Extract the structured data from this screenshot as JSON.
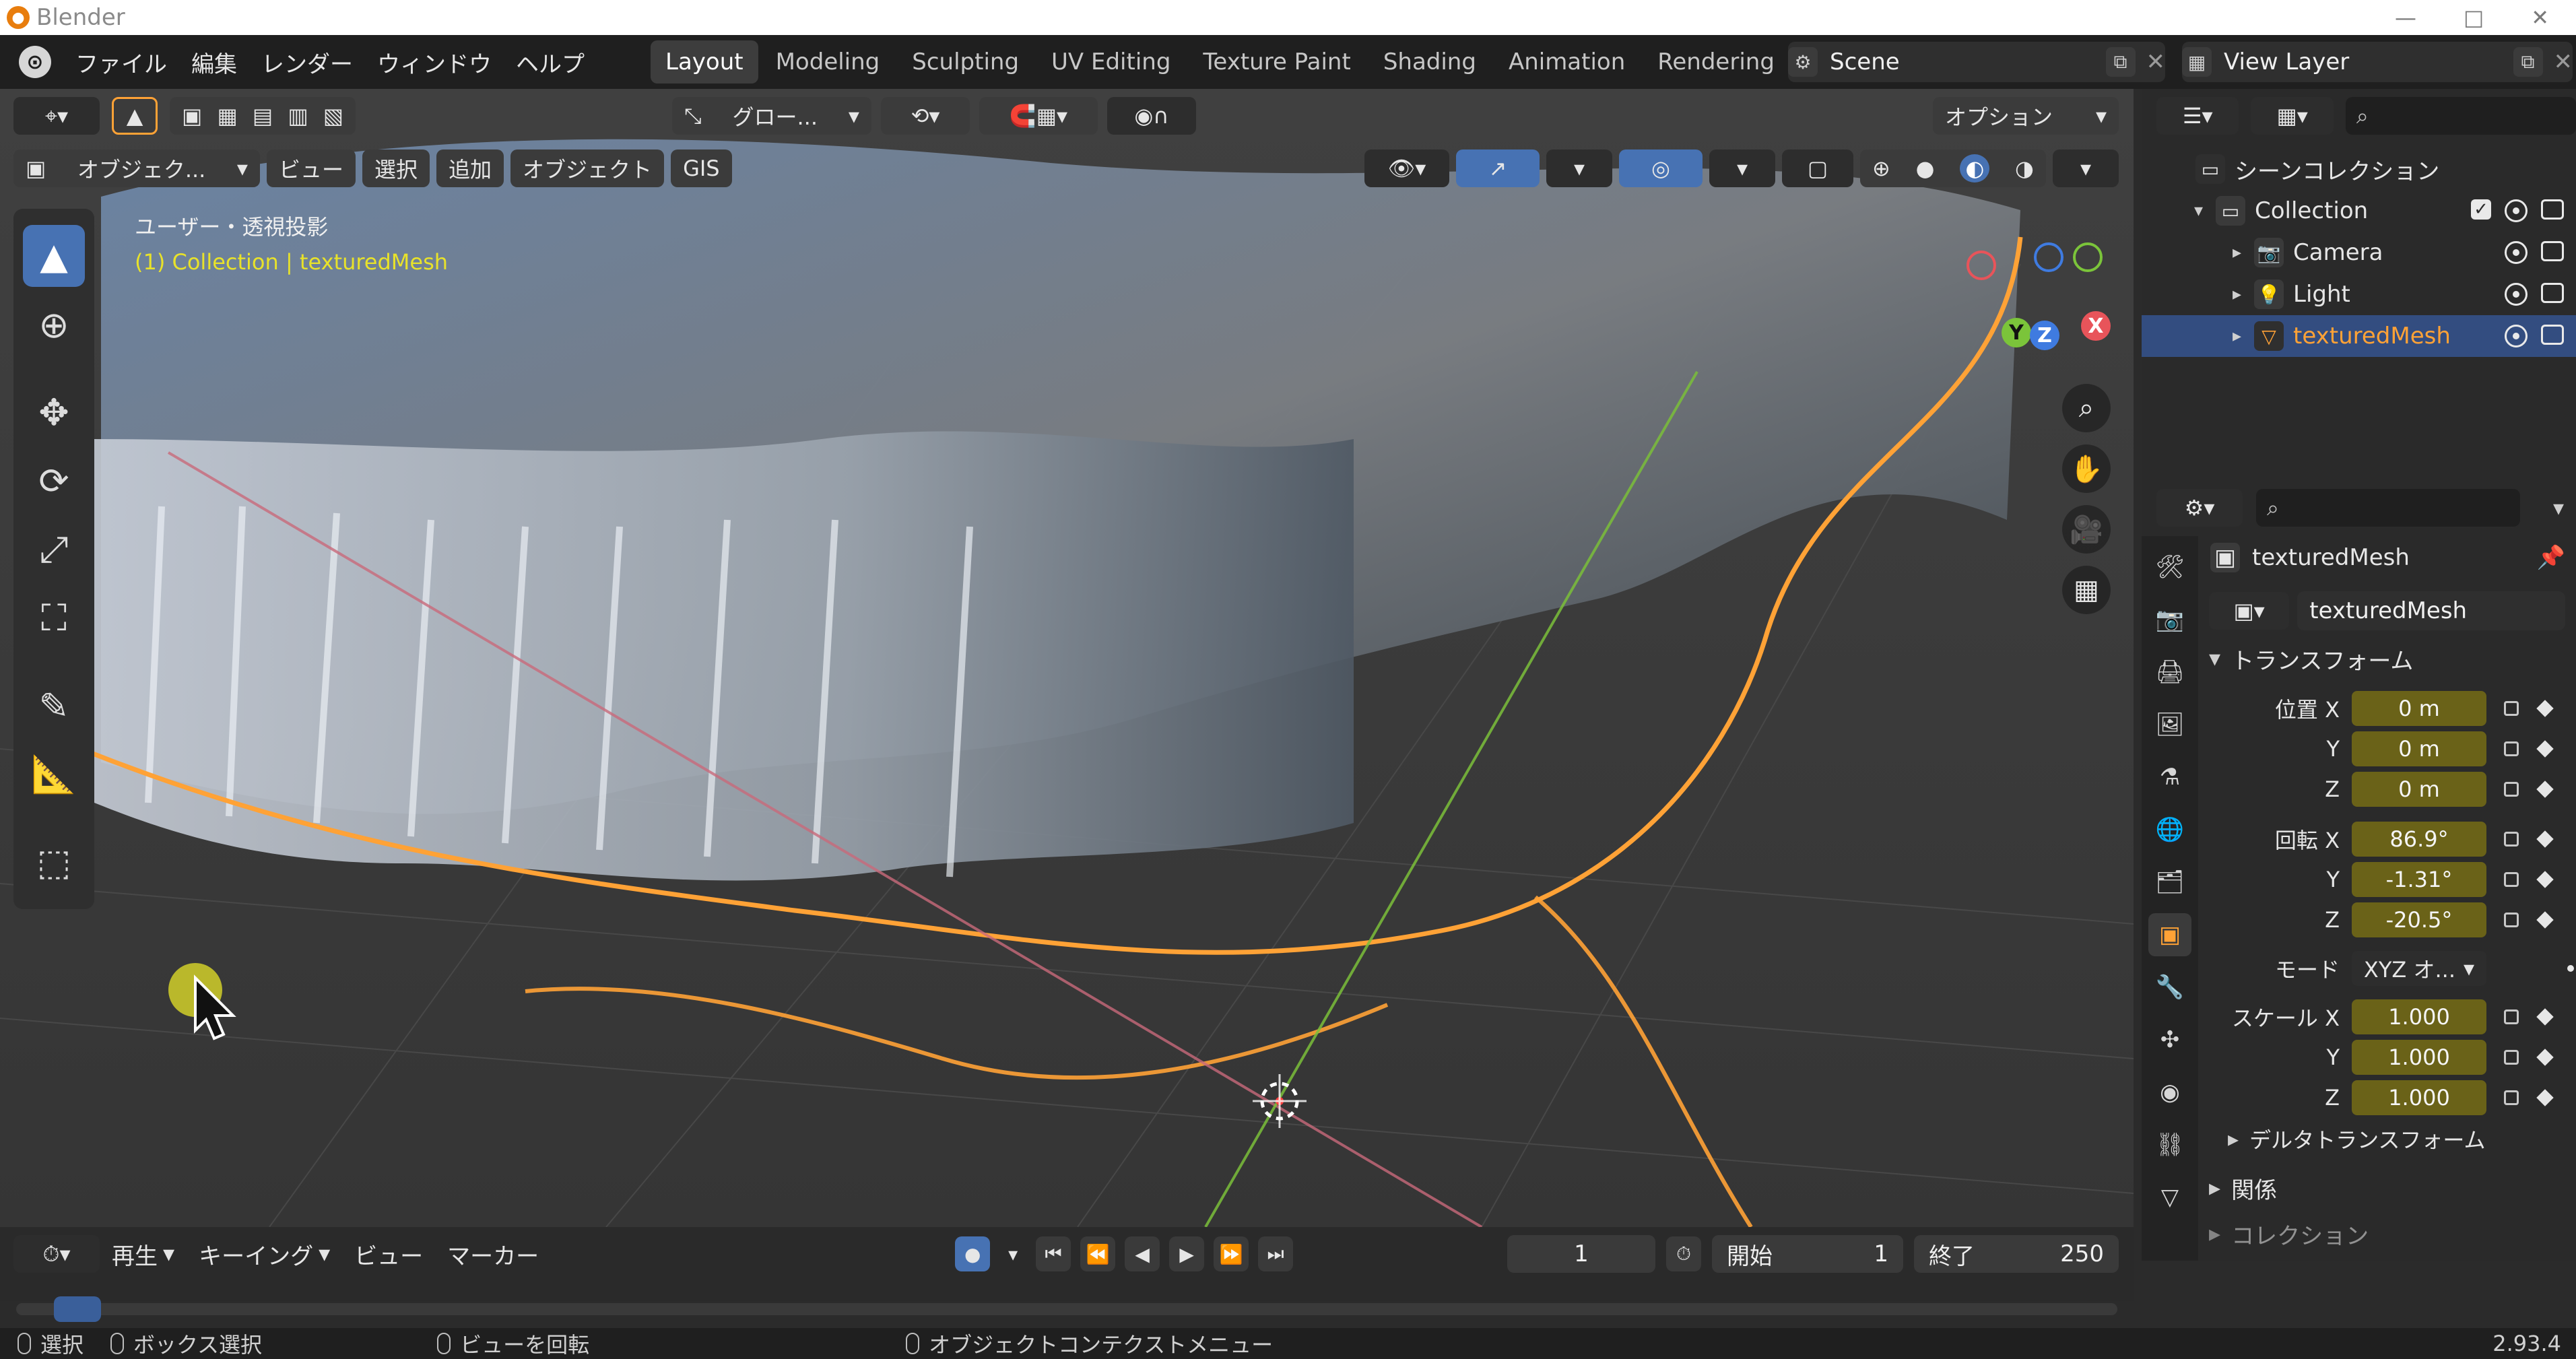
{
  "window": {
    "title": "Blender",
    "app_icon": "blender-icon"
  },
  "menu": {
    "items": [
      "ファイル",
      "編集",
      "レンダー",
      "ウィンドウ",
      "ヘルプ"
    ]
  },
  "workspaces": {
    "tabs": [
      "Layout",
      "Modeling",
      "Sculpting",
      "UV Editing",
      "Texture Paint",
      "Shading",
      "Animation",
      "Rendering"
    ],
    "active": "Layout"
  },
  "scene": {
    "name": "Scene",
    "view_layer": "View Layer"
  },
  "viewport": {
    "mode_label": "オブジェク...",
    "menus": [
      "ビュー",
      "選択",
      "追加",
      "オブジェクト",
      "GIS"
    ],
    "transform_orientation": "グロー...",
    "options_label": "オプション",
    "info_line1": "ユーザー・透視投影",
    "info_line2": "(1) Collection | texturedMesh",
    "gizmo": {
      "x": "X",
      "y": "Y",
      "z": "Z"
    }
  },
  "outliner": {
    "scene_collection": "シーンコレクション",
    "items": [
      {
        "name": "Collection"
      },
      {
        "name": "Camera"
      },
      {
        "name": "Light"
      },
      {
        "name": "texturedMesh"
      }
    ]
  },
  "properties": {
    "object_name": "texturedMesh",
    "mesh_name": "texturedMesh",
    "transform_title": "トランスフォーム",
    "location_label": "位置 X",
    "rotation_label": "回転 X",
    "mode_label": "モード",
    "scale_label": "スケール X",
    "y_label": "Y",
    "z_label": "Z",
    "location": {
      "x": "0 m",
      "y": "0 m",
      "z": "0 m"
    },
    "rotation": {
      "x": "86.9°",
      "y": "-1.31°",
      "z": "-20.5°"
    },
    "mode_value": "XYZ オ...",
    "scale": {
      "x": "1.000",
      "y": "1.000",
      "z": "1.000"
    },
    "delta_title": "デルタトランスフォーム",
    "relations_title": "関係",
    "collections_title": "コレクション"
  },
  "timeline": {
    "playback": "再生",
    "keying": "キーイング",
    "view": "ビュー",
    "marker": "マーカー",
    "current_frame": "1",
    "start_label": "開始",
    "start_value": "1",
    "end_label": "終了",
    "end_value": "250"
  },
  "statusbar": {
    "select": "選択",
    "box_select": "ボックス選択",
    "rotate_view": "ビューを回転",
    "context_menu": "オブジェクトコンテクストメニュー",
    "version": "2.93.4"
  },
  "colors": {
    "accent": "#4772b3",
    "selection_outline": "#ffa236",
    "active_text": "#e8e22a"
  }
}
